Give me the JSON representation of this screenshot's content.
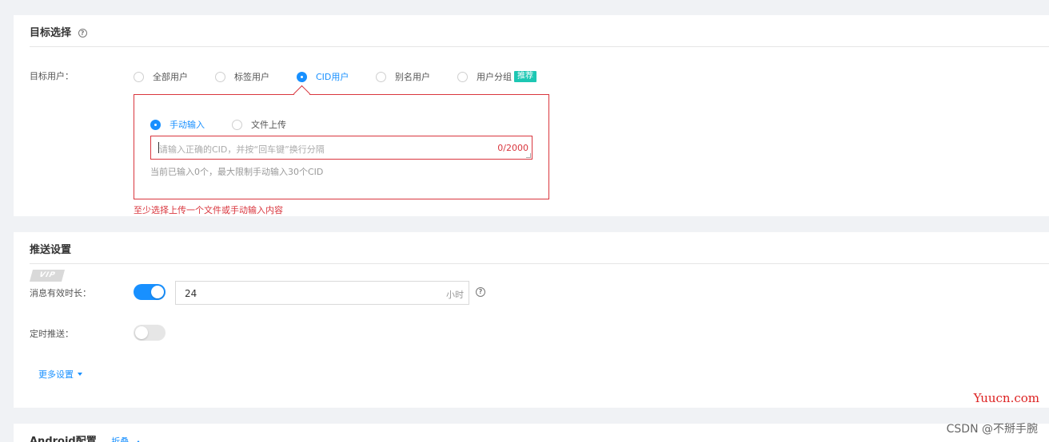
{
  "target": {
    "title": "目标选择",
    "target_user_label": "目标用户：",
    "options": [
      {
        "label": "全部用户",
        "selected": false
      },
      {
        "label": "标签用户",
        "selected": false
      },
      {
        "label": "CID用户",
        "selected": true
      },
      {
        "label": "别名用户",
        "selected": false
      },
      {
        "label": "用户分组",
        "selected": false,
        "tag": "推荐"
      }
    ],
    "input_modes": [
      {
        "label": "手动输入",
        "selected": true
      },
      {
        "label": "文件上传",
        "selected": false
      }
    ],
    "cid_placeholder": "请输入正确的CID，并按“回车键”换行分隔",
    "cid_counter": "0/2000",
    "cid_hint": "当前已输入0个，最大限制手动输入30个CID",
    "error": "至少选择上传一个文件或手动输入内容"
  },
  "push": {
    "title": "推送设置",
    "vip_badge": "VIP",
    "ttl_label": "消息有效时长：",
    "ttl_enabled": true,
    "ttl_value": "24",
    "ttl_unit": "小时",
    "schedule_label": "定时推送：",
    "schedule_enabled": false,
    "more_settings": "更多设置"
  },
  "android": {
    "title": "Android配置",
    "collapse": "折叠"
  },
  "watermarks": {
    "site": "Yuucn.com",
    "author": "CSDN @不掰手腕"
  },
  "colors": {
    "accent": "#1890ff",
    "error": "#d9363e",
    "tag": "#1dc7b3"
  }
}
